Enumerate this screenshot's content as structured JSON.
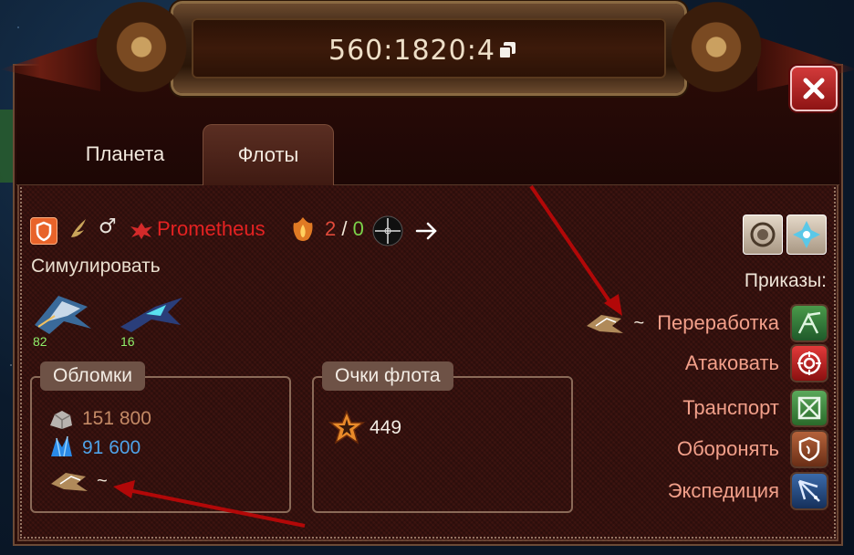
{
  "header": {
    "coordinates": "560:1820:4"
  },
  "tabs": [
    {
      "label": "Планета",
      "active": false
    },
    {
      "label": "Флоты",
      "active": true
    }
  ],
  "player": {
    "name": "Prometheus",
    "attack_count": "2",
    "separator": "/",
    "defense_count": "0"
  },
  "simulate_label": "Симулировать",
  "ships": [
    {
      "count": "82"
    },
    {
      "count": "16"
    }
  ],
  "debris": {
    "title": "Обломки",
    "metal": "151 800",
    "crystal": "91 600",
    "recycler_time": "~"
  },
  "fleet_points": {
    "title": "Очки флота",
    "value": "449"
  },
  "orders": {
    "title": "Приказы:",
    "recycle_time": "~",
    "items": [
      {
        "label": "Переработка"
      },
      {
        "label": "Атаковать"
      },
      {
        "label": "Транспорт"
      },
      {
        "label": "Оборонять"
      },
      {
        "label": "Экспедиция"
      }
    ]
  },
  "colors": {
    "player_name": "#e42222",
    "metal": "#c48a66",
    "crystal": "#4fa2e8",
    "order_label": "#f2a08a"
  }
}
